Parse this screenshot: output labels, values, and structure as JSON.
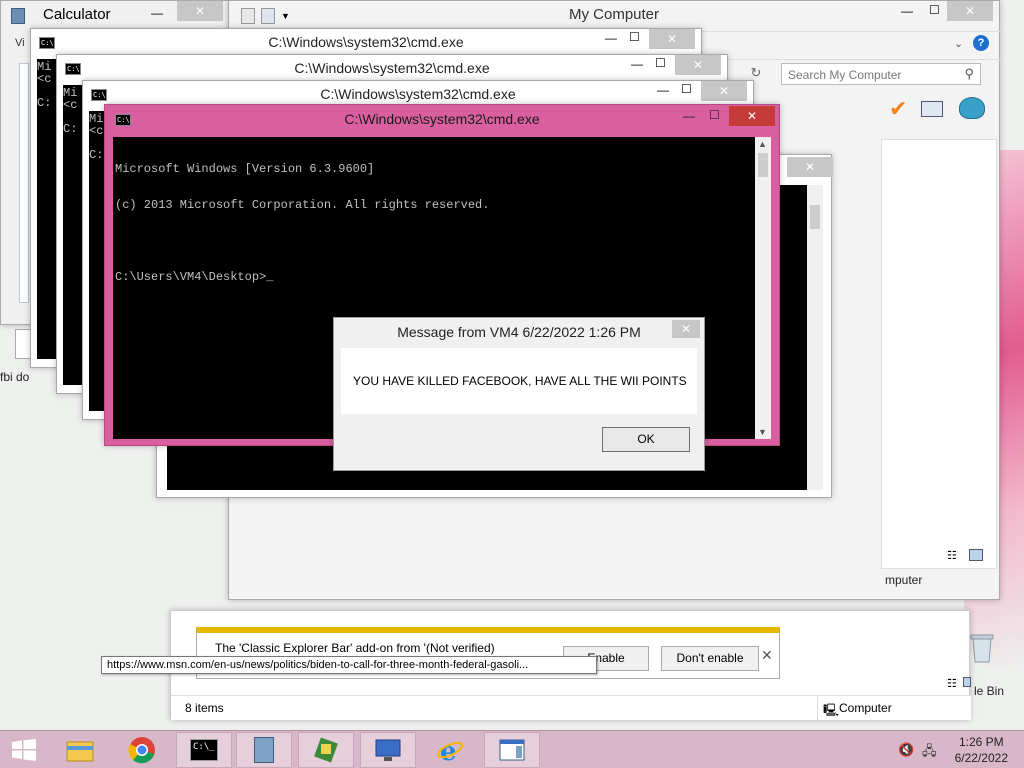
{
  "calculator": {
    "title": "Calculator",
    "menu_label": "Vi"
  },
  "my_computer": {
    "title": "My Computer",
    "search_placeholder": "Search My Computer",
    "status_items": "8 items",
    "status_location": "Computer",
    "nav_computer_label": "mputer"
  },
  "cmd_windows": [
    {
      "title": "C:\\Windows\\system32\\cmd.exe",
      "preview": "Mi\n<c\n\nC:"
    },
    {
      "title": "C:\\Windows\\system32\\cmd.exe",
      "preview": "Mi\n<c\n\nC:"
    },
    {
      "title": "C:\\Windows\\system32\\cmd.exe",
      "preview": "Mi\n<c\n\nC:"
    },
    {
      "title": "C:\\Windows\\system32\\cmd.exe",
      "lines": [
        "Microsoft Windows [Version 6.3.9600]",
        "(c) 2013 Microsoft Corporation. All rights reserved.",
        "",
        "C:\\Users\\VM4\\Desktop>_"
      ]
    }
  ],
  "message_box": {
    "title": "Message from VM4 6/22/2022 1:26 PM",
    "text": "YOU HAVE KILLED FACEBOOK, HAVE ALL THE WII POINTS",
    "ok_label": "OK"
  },
  "addon_bar": {
    "text": "The 'Classic Explorer Bar' add-on from '(Not verified)",
    "enable_label": "Enable",
    "dont_enable_label": "Don't enable",
    "tooltip_url": "https://www.msn.com/en-us/news/politics/biden-to-call-for-three-month-federal-gasoli..."
  },
  "desktop": {
    "fbi_label": "fbi do",
    "recycle_label": "le Bin"
  },
  "taskbar": {
    "time": "1:26 PM",
    "date": "6/22/2022",
    "items": [
      "start",
      "file-explorer",
      "chrome",
      "cmd",
      "calculator",
      "network-app",
      "remote-desktop",
      "internet-explorer",
      "explorer-window"
    ]
  },
  "colors": {
    "cmd_accent": "#d95fa0",
    "taskbar": "#d8b8c8",
    "addon_bar_accent": "#e6b800"
  }
}
